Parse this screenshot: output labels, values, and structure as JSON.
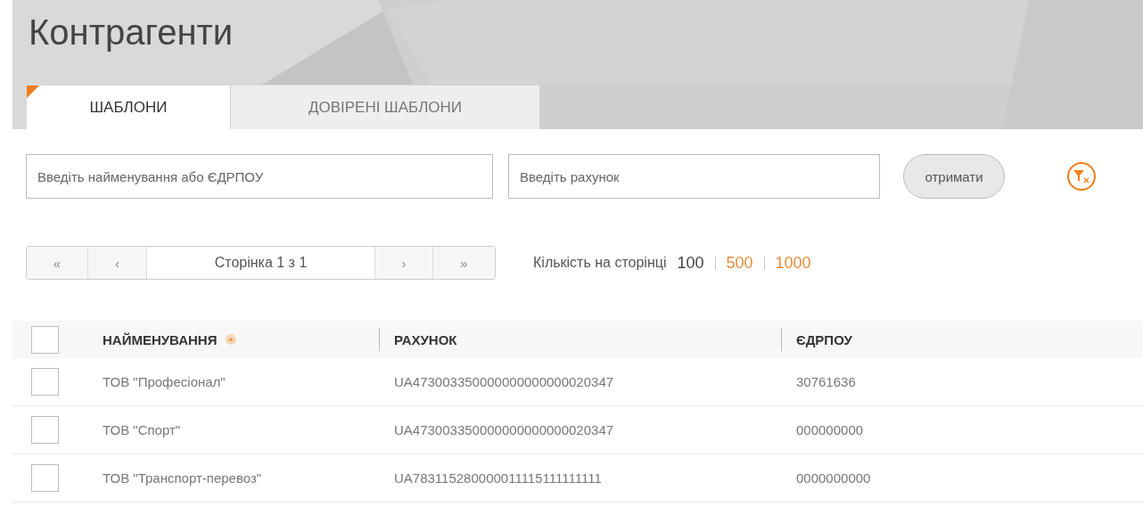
{
  "title": "Контрагенти",
  "tabs": [
    {
      "label": "ШАБЛОНИ",
      "selected": true
    },
    {
      "label": "ДОВІРЕНІ ШАБЛОНИ",
      "selected": false
    }
  ],
  "filters": {
    "name_field": {
      "placeholder": "Введіть найменування або ЄДРПОУ"
    },
    "account_field": {
      "placeholder": "Введіть рахунок"
    },
    "submit_button": "отримати"
  },
  "pager": {
    "first": {
      "label": "«",
      "disabled": true
    },
    "prev": {
      "label": "‹",
      "disabled": true
    },
    "page_label": "Сторінка 1 з 1",
    "next": {
      "label": "›",
      "disabled": true
    },
    "last": {
      "label": "»",
      "disabled": true
    }
  },
  "page_size": {
    "label": "Кількість на сторінці",
    "options": [
      {
        "label": "100",
        "selected": true
      },
      {
        "label": "500",
        "selected": false
      },
      {
        "label": "1000",
        "selected": false
      }
    ]
  },
  "table": {
    "select_all_checked": false,
    "columns": [
      {
        "label": "НАЙМЕНУВАННЯ",
        "sorted": true
      },
      {
        "label": "РАХУНОК",
        "sorted": false
      },
      {
        "label": "ЄДРПОУ",
        "sorted": false
      }
    ],
    "rows": [
      {
        "checked": false,
        "cells": [
          "ТОВ \"Професіонал\"",
          "UA473003350000000000000020347",
          "30761636"
        ]
      },
      {
        "checked": false,
        "cells": [
          "ТОВ \"Спорт\"",
          "UA473003350000000000000020347",
          "000000000"
        ]
      },
      {
        "checked": false,
        "cells": [
          "ТОВ \"Транспорт-перевоз\"",
          "UA783115280000011115111111111",
          "0000000000"
        ]
      }
    ]
  }
}
